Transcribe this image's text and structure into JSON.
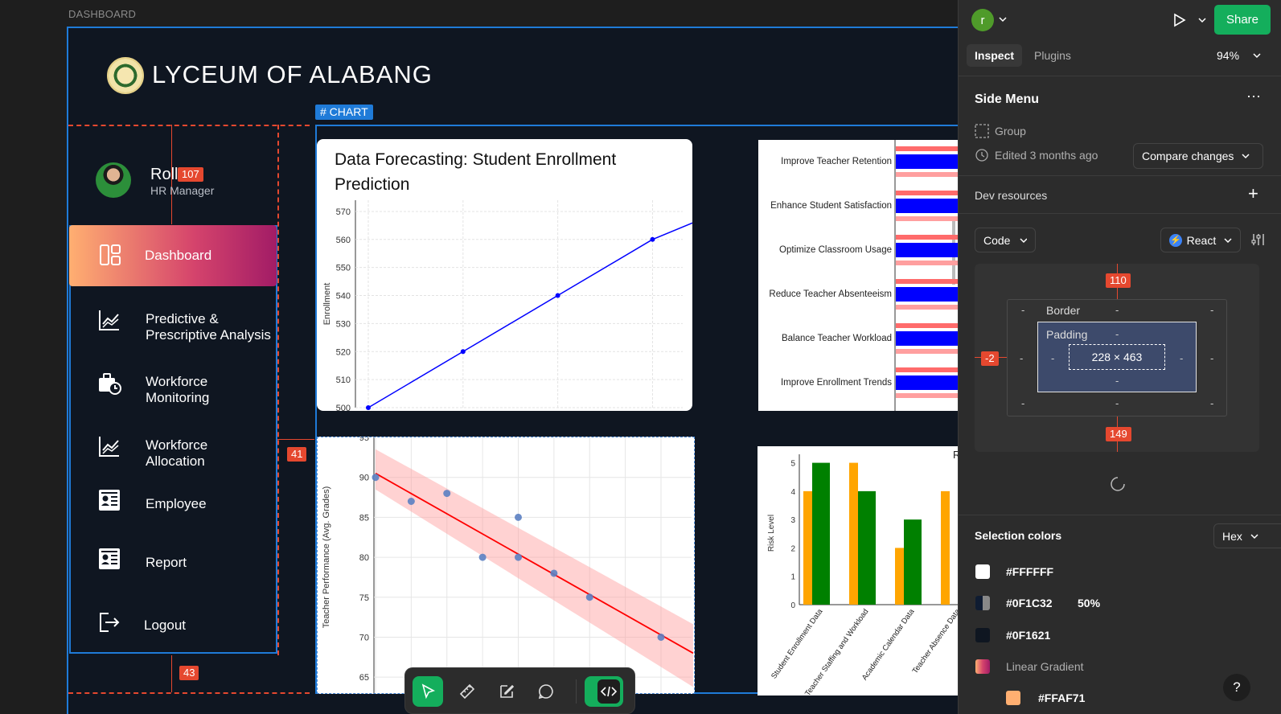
{
  "canvas": {
    "frame_label": "DASHBOARD",
    "school_name": "LYCEUM OF ALABANG",
    "user": {
      "name": "Roll",
      "role": "HR Manager"
    },
    "measures": {
      "top": "107",
      "right": "41",
      "bottom": "43"
    },
    "chart_tag": "# CHART",
    "nav": [
      {
        "label": "Dashboard",
        "icon": "dashboard-icon"
      },
      {
        "label": "Predictive &\nPrescriptive Analysis",
        "icon": "chart-line-icon"
      },
      {
        "label": "Workforce\nMonitoring",
        "icon": "briefcase-clock-icon"
      },
      {
        "label": "Workforce\nAllocation",
        "icon": "chart-line-icon"
      },
      {
        "label": "Employee",
        "icon": "id-card-icon"
      },
      {
        "label": "Report",
        "icon": "report-icon"
      },
      {
        "label": "Logout",
        "icon": "logout-icon"
      }
    ]
  },
  "chart_data": [
    {
      "type": "line",
      "title": "Data Forecasting: Student Enrollment Prediction",
      "xlabel": "",
      "ylabel": "Enrollment",
      "x": [
        0,
        1,
        2,
        3,
        4
      ],
      "y": [
        500,
        520,
        540,
        560,
        574
      ],
      "ylim": [
        500,
        574
      ],
      "y_ticks": [
        500,
        510,
        520,
        530,
        540,
        550,
        560,
        570
      ],
      "grid": true
    },
    {
      "type": "bar",
      "orientation": "horizontal",
      "categories": [
        "Improve Teacher Retention",
        "Enhance Student Satisfaction",
        "Optimize Classroom Usage",
        "Reduce Teacher Absenteeism",
        "Balance Teacher Workload",
        "Improve Enrollment Trends"
      ]
    },
    {
      "type": "scatter",
      "ylabel": "Teacher Performance (Avg. Grades)",
      "y_ticks": [
        65,
        70,
        75,
        80,
        85,
        90,
        95
      ],
      "points": [
        [
          1,
          90
        ],
        [
          2,
          87
        ],
        [
          3,
          88
        ],
        [
          4,
          80
        ],
        [
          5,
          85
        ],
        [
          5,
          80
        ],
        [
          6,
          78
        ],
        [
          7,
          75
        ],
        [
          8,
          65
        ],
        [
          9,
          70
        ]
      ],
      "trend": {
        "from": 90.5,
        "to": 68
      },
      "ylim": [
        63,
        95
      ]
    },
    {
      "type": "bar",
      "title": "Risk Assessme",
      "ylabel": "Risk Level",
      "categories": [
        "Student Enrollment Data",
        "Teacher Staffing and Workload",
        "Academic Calendar Data",
        "Teacher Absence Data"
      ],
      "series": [
        {
          "values": [
            4,
            5,
            2,
            4
          ],
          "color": "#ffa500"
        },
        {
          "values": [
            5,
            4,
            3,
            0
          ],
          "color": "#008000"
        }
      ],
      "ylim": [
        0,
        5.3
      ],
      "y_ticks": [
        0,
        1,
        2,
        3,
        4,
        5
      ]
    }
  ],
  "panel": {
    "avatar_letter": "r",
    "share": "Share",
    "tabs": {
      "inspect": "Inspect",
      "plugins": "Plugins"
    },
    "zoom": "94%",
    "section_title": "Side Menu",
    "layer_type": "Group",
    "edited": "Edited 3 months ago",
    "compare": "Compare changes",
    "dev_resources": "Dev resources",
    "code_label": "Code",
    "framework": "React",
    "box": {
      "top": "110",
      "left": "-2",
      "bottom": "149",
      "border": "Border",
      "padding": "Padding",
      "size": "228 × 463",
      "dash": "-"
    },
    "selection_colors_title": "Selection colors",
    "color_format": "Hex",
    "colors": [
      {
        "hex": "#FFFFFF",
        "opacity": "",
        "swatch": "#FFFFFF"
      },
      {
        "hex": "#0F1C32",
        "opacity": "50%",
        "swatch": "#0F1C32"
      },
      {
        "hex": "#0F1621",
        "opacity": "",
        "swatch": "#0F1621"
      },
      {
        "hex": "Linear Gradient",
        "opacity": "",
        "swatch": "gradient"
      },
      {
        "hex": "#FFAF71",
        "opacity": "",
        "swatch": "#FFAF71"
      }
    ],
    "help": "?"
  }
}
